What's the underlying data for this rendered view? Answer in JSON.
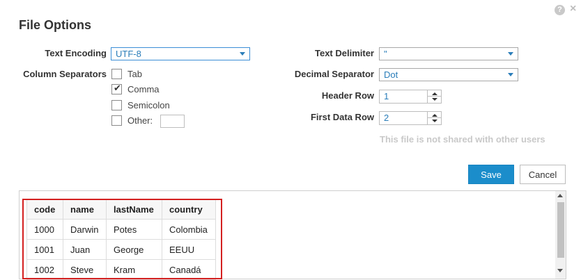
{
  "dialog": {
    "title": "File Options",
    "help_icon": "?",
    "close_icon": "×"
  },
  "left": {
    "text_encoding_label": "Text Encoding",
    "text_encoding_value": "UTF-8",
    "column_separators_label": "Column Separators",
    "separators": [
      {
        "label": "Tab",
        "checked": false
      },
      {
        "label": "Comma",
        "checked": true
      },
      {
        "label": "Semicolon",
        "checked": false
      },
      {
        "label": "Other:",
        "checked": false
      }
    ],
    "check_glyph": "✔"
  },
  "right": {
    "text_delimiter_label": "Text Delimiter",
    "text_delimiter_value": "\"",
    "decimal_separator_label": "Decimal Separator",
    "decimal_separator_value": "Dot",
    "header_row_label": "Header Row",
    "header_row_value": "1",
    "first_data_row_label": "First Data Row",
    "first_data_row_value": "2",
    "notice": "This file is not shared with other users"
  },
  "actions": {
    "save_label": "Save",
    "cancel_label": "Cancel"
  },
  "preview": {
    "columns": [
      "code",
      "name",
      "lastName",
      "country"
    ],
    "rows": [
      [
        "1000",
        "Darwin",
        "Potes",
        "Colombia"
      ],
      [
        "1001",
        "Juan",
        "George",
        "EEUU"
      ],
      [
        "1002",
        "Steve",
        "Kram",
        "Canadá"
      ]
    ]
  },
  "colors": {
    "accent": "#1b8dcb",
    "highlight": "#d42020",
    "notice": "#c9c9c9",
    "value_text": "#2a7db9"
  }
}
